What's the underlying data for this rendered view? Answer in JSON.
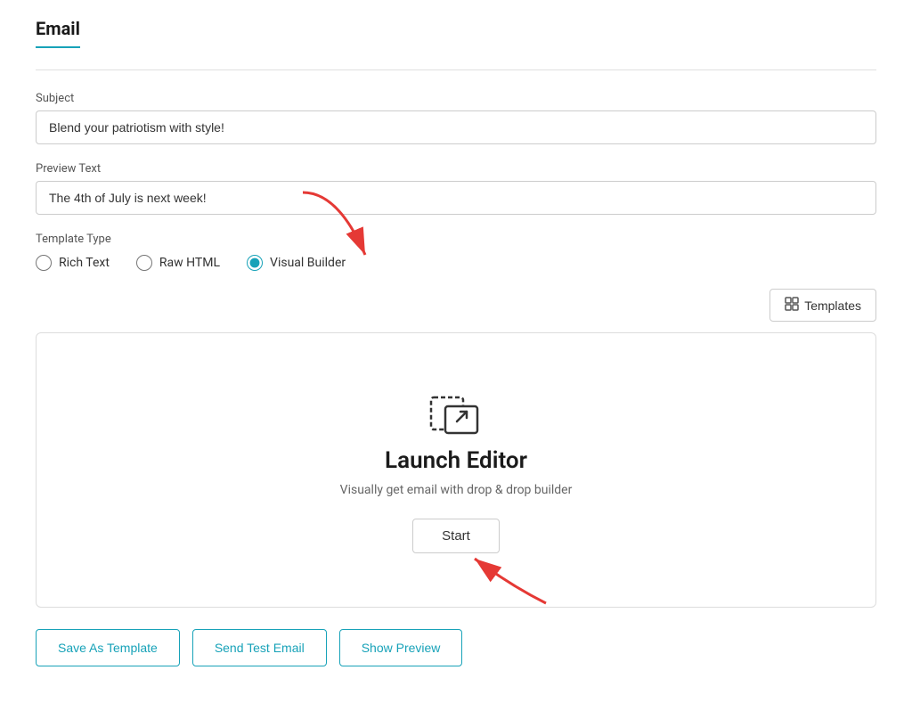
{
  "page": {
    "title": "Email"
  },
  "subject": {
    "label": "Subject",
    "value": "Blend your patriotism with style!"
  },
  "preview_text": {
    "label": "Preview Text",
    "value": "The 4th of July is next week!"
  },
  "template_type": {
    "label": "Template Type",
    "options": [
      {
        "id": "rich-text",
        "label": "Rich Text",
        "checked": false
      },
      {
        "id": "raw-html",
        "label": "Raw HTML",
        "checked": false
      },
      {
        "id": "visual-builder",
        "label": "Visual Builder",
        "checked": true
      }
    ]
  },
  "templates_button": {
    "label": "Templates"
  },
  "editor": {
    "title": "Launch Editor",
    "subtitle": "Visually get email with drop & drop builder",
    "start_label": "Start"
  },
  "bottom_buttons": {
    "save_template": "Save As Template",
    "send_test": "Send Test Email",
    "show_preview": "Show Preview"
  }
}
